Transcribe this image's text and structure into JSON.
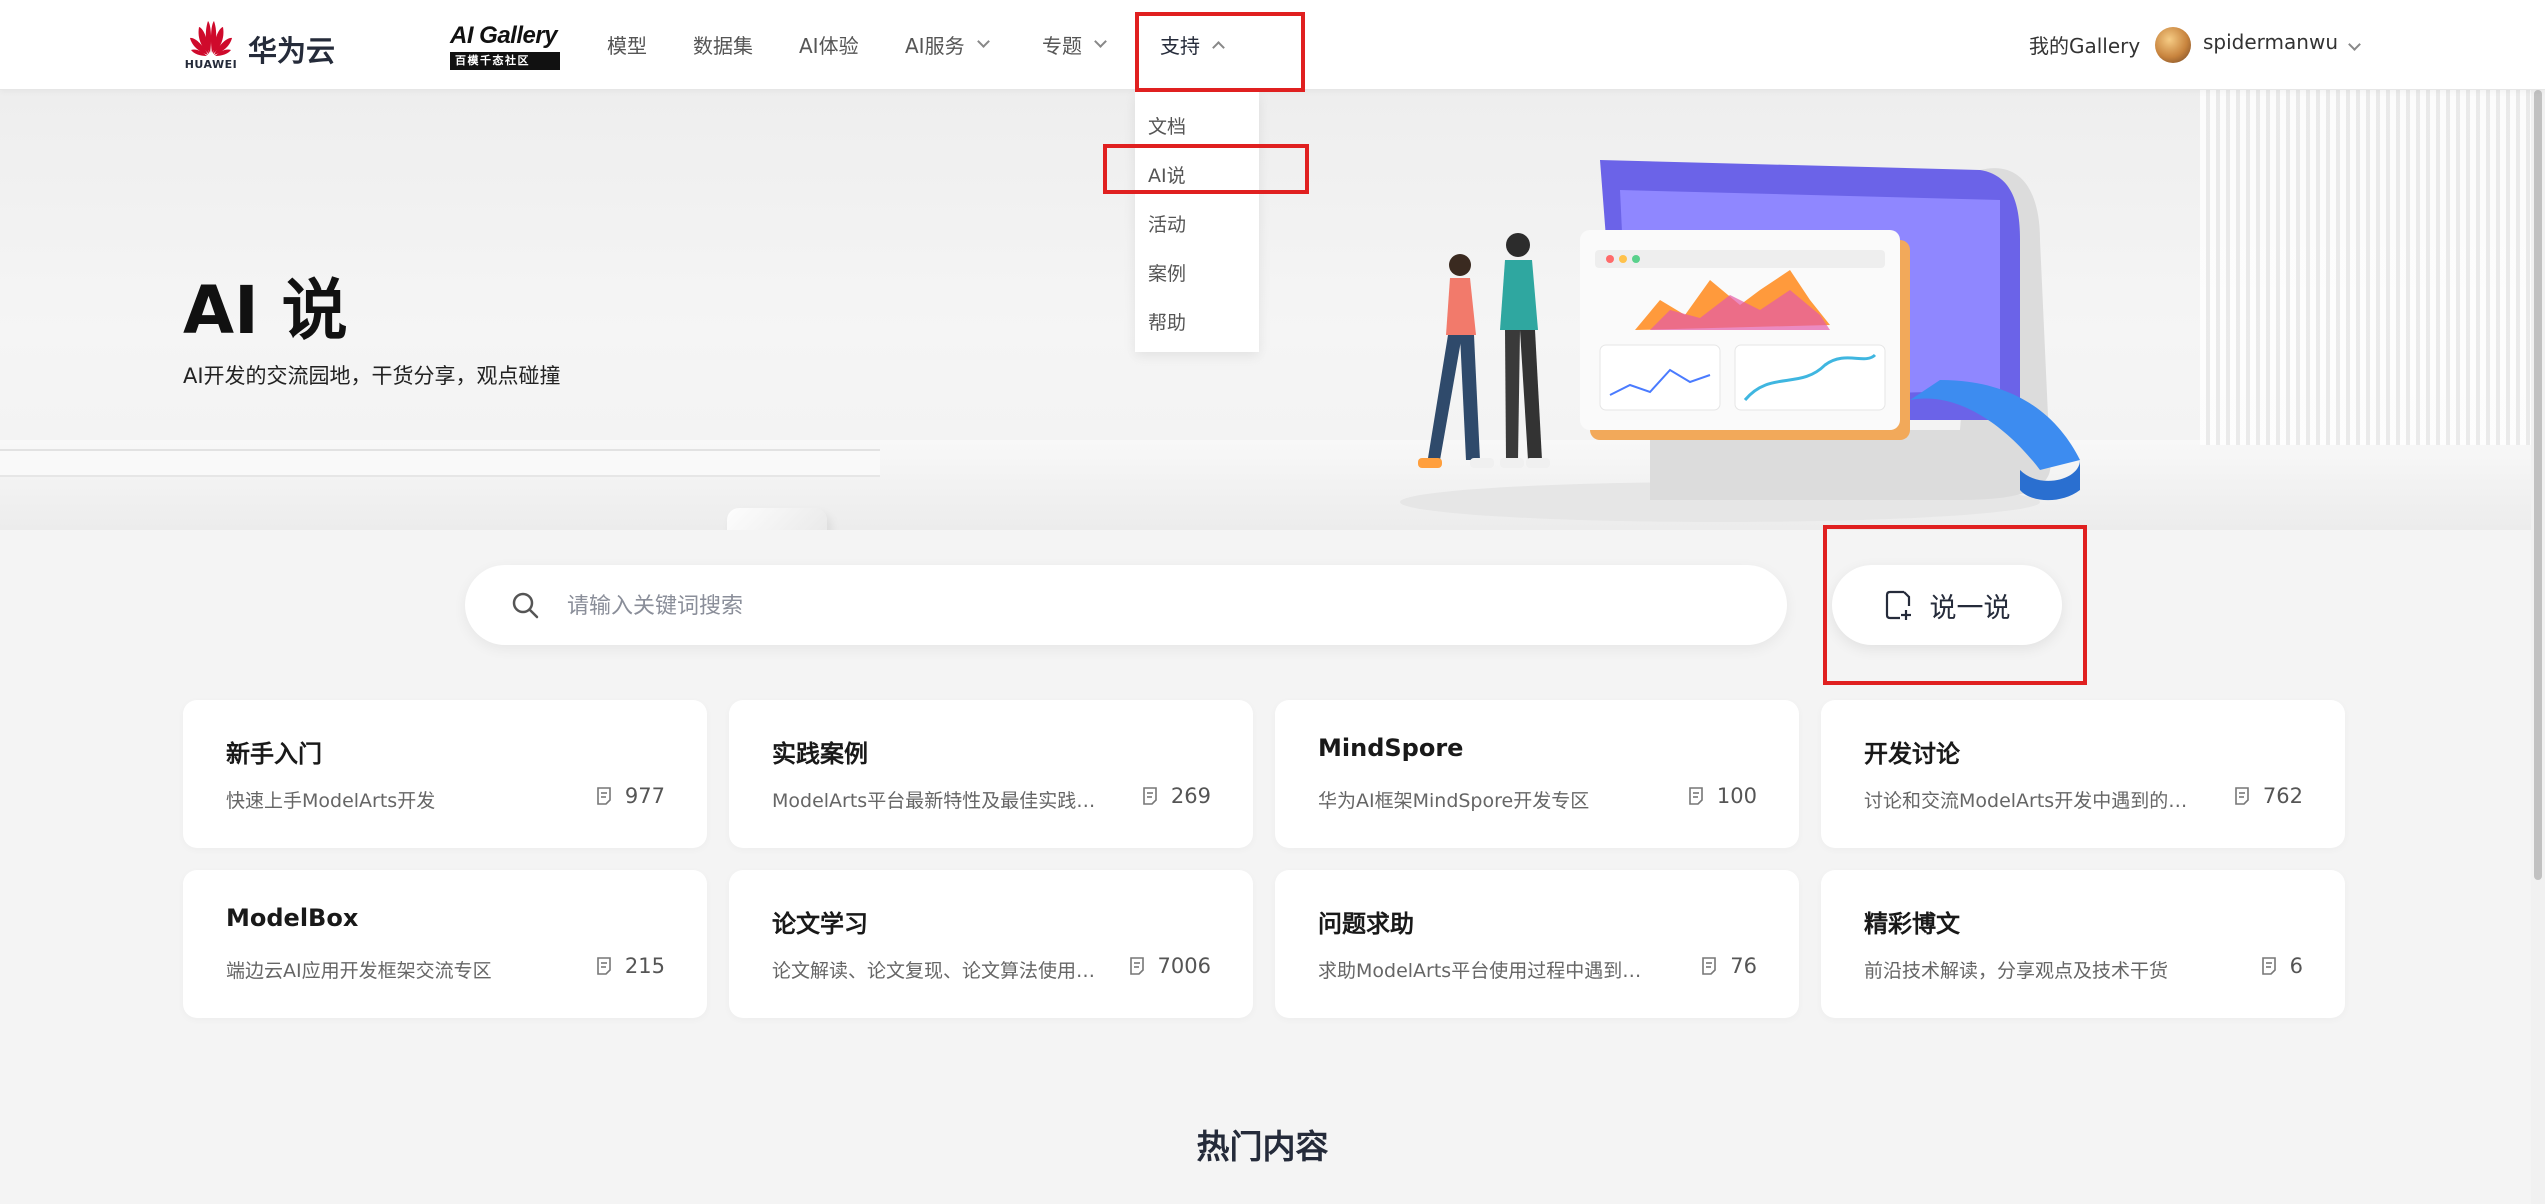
{
  "header": {
    "logo_text": "HUAWEI",
    "brand": "华为云",
    "gallery_title": "AI Gallery",
    "gallery_subtitle": "百模千态社区",
    "nav": [
      {
        "label": "模型"
      },
      {
        "label": "数据集"
      },
      {
        "label": "AI体验"
      },
      {
        "label": "AI服务"
      },
      {
        "label": "专题"
      },
      {
        "label": "支持"
      }
    ],
    "my_gallery": "我的Gallery",
    "username": "spidermanwu"
  },
  "support_menu": {
    "items": [
      "文档",
      "AI说",
      "活动",
      "案例",
      "帮助"
    ]
  },
  "hero": {
    "title": "AI 说",
    "subtitle": "AI开发的交流园地，干货分享，观点碰撞"
  },
  "search": {
    "placeholder": "请输入关键词搜索"
  },
  "post_button": "说一说",
  "categories": [
    {
      "title": "新手入门",
      "desc": "快速上手ModelArts开发",
      "count": "977"
    },
    {
      "title": "实践案例",
      "desc": "ModelArts平台最新特性及最佳实践案例",
      "count": "269"
    },
    {
      "title": "MindSpore",
      "desc": "华为AI框架MindSpore开发专区",
      "count": "100"
    },
    {
      "title": "开发讨论",
      "desc": "讨论和交流ModelArts开发中遇到的问题",
      "count": "762"
    },
    {
      "title": "ModelBox",
      "desc": "端边云AI应用开发框架交流专区",
      "count": "215"
    },
    {
      "title": "论文学习",
      "desc": "论文解读、论文复现、论文算法使用、…",
      "count": "7006"
    },
    {
      "title": "问题求助",
      "desc": "求助ModelArts平台使用过程中遇到的问…",
      "count": "76"
    },
    {
      "title": "精彩博文",
      "desc": "前沿技术解读，分享观点及技术干货",
      "count": "6"
    }
  ],
  "hot_section_title": "热门内容",
  "colors": {
    "highlight": "#e02020",
    "huawei_red": "#cf0a2c",
    "text_dark": "#252b3a"
  }
}
